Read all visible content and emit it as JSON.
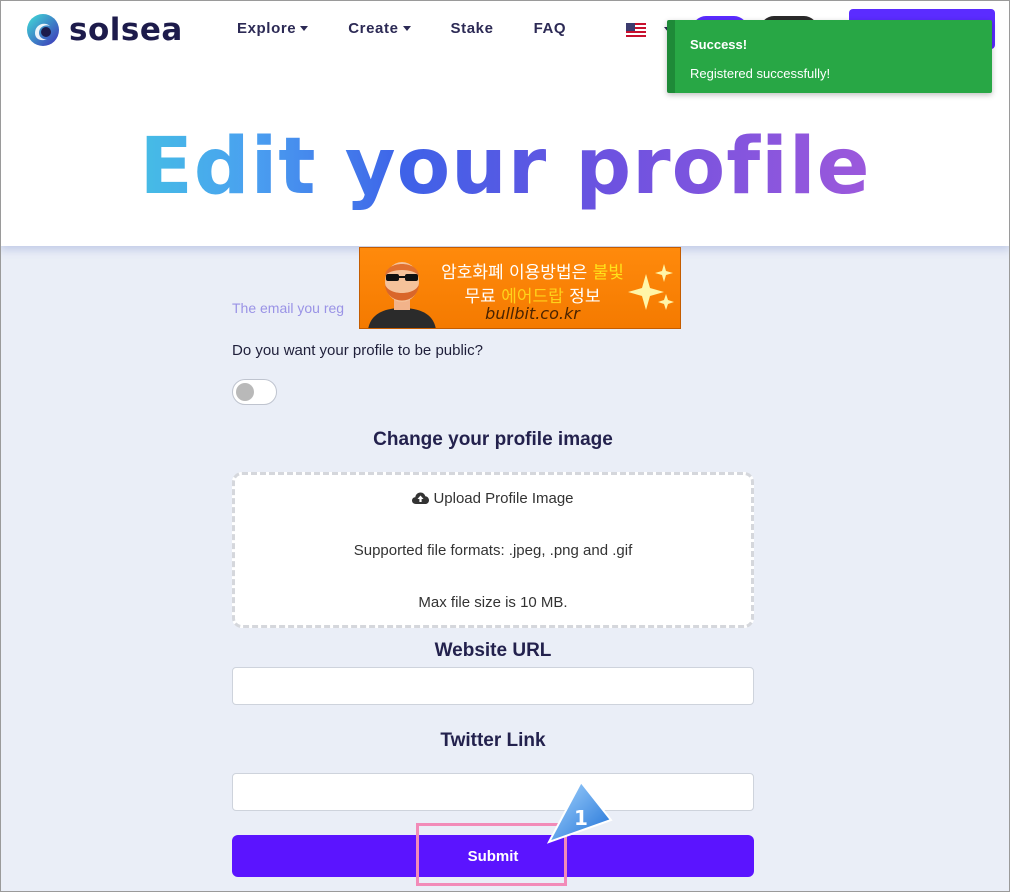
{
  "header": {
    "brand": "solsea",
    "nav": [
      {
        "label": "Explore",
        "dropdown": true
      },
      {
        "label": "Create",
        "dropdown": true
      },
      {
        "label": "Stake",
        "dropdown": false
      },
      {
        "label": "FAQ",
        "dropdown": false
      }
    ],
    "language_flag": "us-flag-icon",
    "accent_color": "#5b2cff"
  },
  "page_title": "Edit your profile",
  "toast": {
    "title": "Success!",
    "message": "Registered successfully!",
    "color": "#28a745"
  },
  "ad": {
    "line1_a": "암호화폐 이용방법은 ",
    "line1_b": "불빛",
    "line2_a": "무료 ",
    "line2_b": "에어드랍",
    "line2_c": " 정보",
    "url": "bullbit.co.kr"
  },
  "form": {
    "email_note": "The email you reg",
    "public_question": "Do you want your profile to be public?",
    "public_toggle_on": false,
    "profile_image_heading": "Change your profile image",
    "upload_label": "Upload Profile Image",
    "supported_formats": "Supported file formats: .jpeg, .png and .gif",
    "max_size": "Max file size is 10 MB.",
    "website_heading": "Website URL",
    "website_value": "",
    "twitter_heading": "Twitter Link",
    "twitter_value": "",
    "submit_label": "Submit"
  },
  "annotation": {
    "step_number": "1"
  }
}
